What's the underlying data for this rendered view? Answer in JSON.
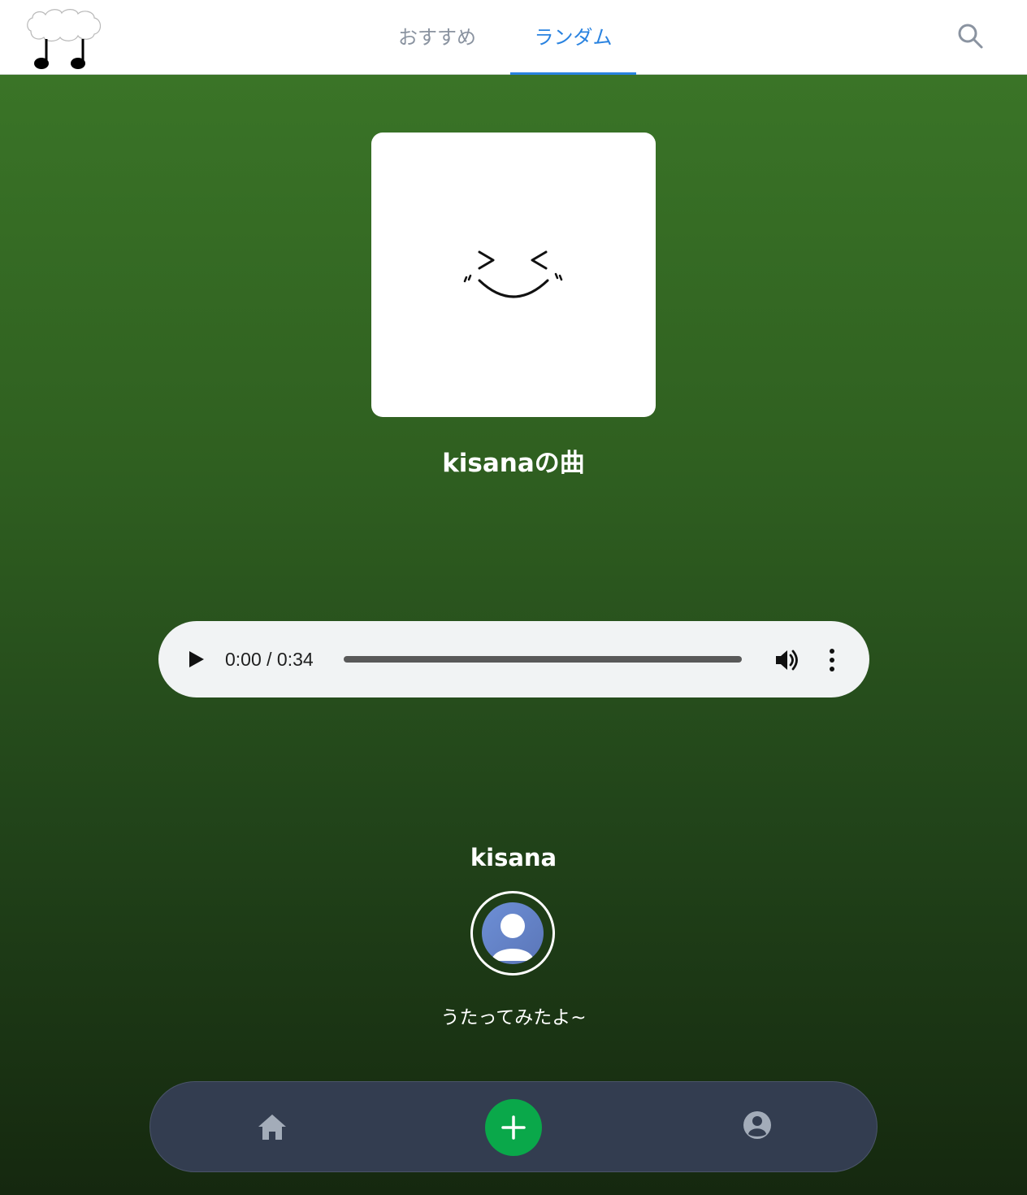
{
  "header": {
    "tabs": [
      {
        "label": "おすすめ",
        "active": false
      },
      {
        "label": "ランダム",
        "active": true
      }
    ],
    "search_icon": "search-icon",
    "logo_icon": "cloud-music-notes-logo"
  },
  "song": {
    "title": "kisanaの曲",
    "artwork_icon": "smiling-face-artwork"
  },
  "player": {
    "time": "0:00 / 0:34",
    "progress": 0,
    "icons": [
      "play-icon",
      "volume-icon",
      "more-options-icon"
    ]
  },
  "artist": {
    "name": "kisana",
    "avatar_icon": "default-user-avatar",
    "description": "うたってみたよ~"
  },
  "bottom_nav": {
    "items": [
      "home-icon",
      "add-icon",
      "profile-icon"
    ],
    "add_color": "#0aa84a",
    "background_color": "#333d50"
  },
  "colors": {
    "accent": "#2a83e0",
    "background_top": "#3a7427",
    "background_bottom": "#15280f"
  }
}
